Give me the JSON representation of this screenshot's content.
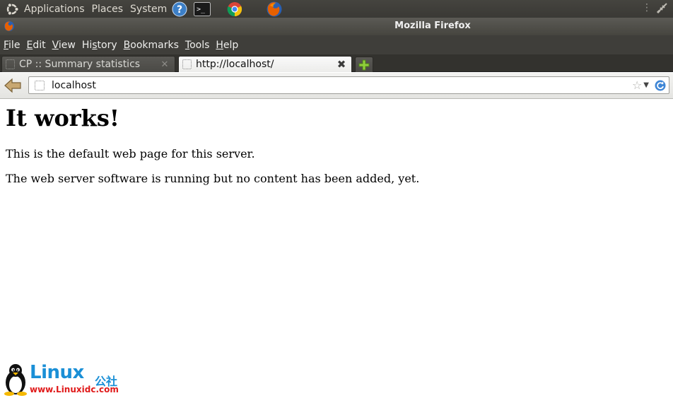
{
  "top_panel": {
    "menus": [
      "Applications",
      "Places",
      "System"
    ],
    "launchers": [
      "help-icon",
      "terminal-icon",
      "chrome-icon",
      "firefox-icon"
    ],
    "right_icons": [
      "panel-handle-icon",
      "network-icon"
    ]
  },
  "window": {
    "title": "Mozilla Firefox"
  },
  "menu_bar": {
    "items": [
      {
        "label": "File",
        "access": "F",
        "rest": "ile"
      },
      {
        "label": "Edit",
        "access": "E",
        "rest": "dit"
      },
      {
        "label": "View",
        "access": "V",
        "rest": "iew"
      },
      {
        "label": "History",
        "access": "s",
        "pre": "Hi",
        "rest": "tory"
      },
      {
        "label": "Bookmarks",
        "access": "B",
        "rest": "ookmarks"
      },
      {
        "label": "Tools",
        "access": "T",
        "rest": "ools"
      },
      {
        "label": "Help",
        "access": "H",
        "rest": "elp"
      }
    ]
  },
  "tabs": [
    {
      "title": "CP :: Summary statistics",
      "active": false
    },
    {
      "title": "http://localhost/",
      "active": true
    }
  ],
  "nav": {
    "url": "localhost"
  },
  "page": {
    "heading": "It works!",
    "paragraphs": [
      "This is the default web page for this server.",
      "The web server software is running but no content has been added, yet."
    ]
  },
  "watermark": {
    "title": "Linux",
    "chinese": "公社",
    "url": "www.Linuxidc.com"
  },
  "colors": {
    "panel_bg": "#3a3935",
    "menu_bg": "#3f3e3a",
    "watermark_blue": "#1a8fd6",
    "watermark_red": "#e01a1a"
  }
}
